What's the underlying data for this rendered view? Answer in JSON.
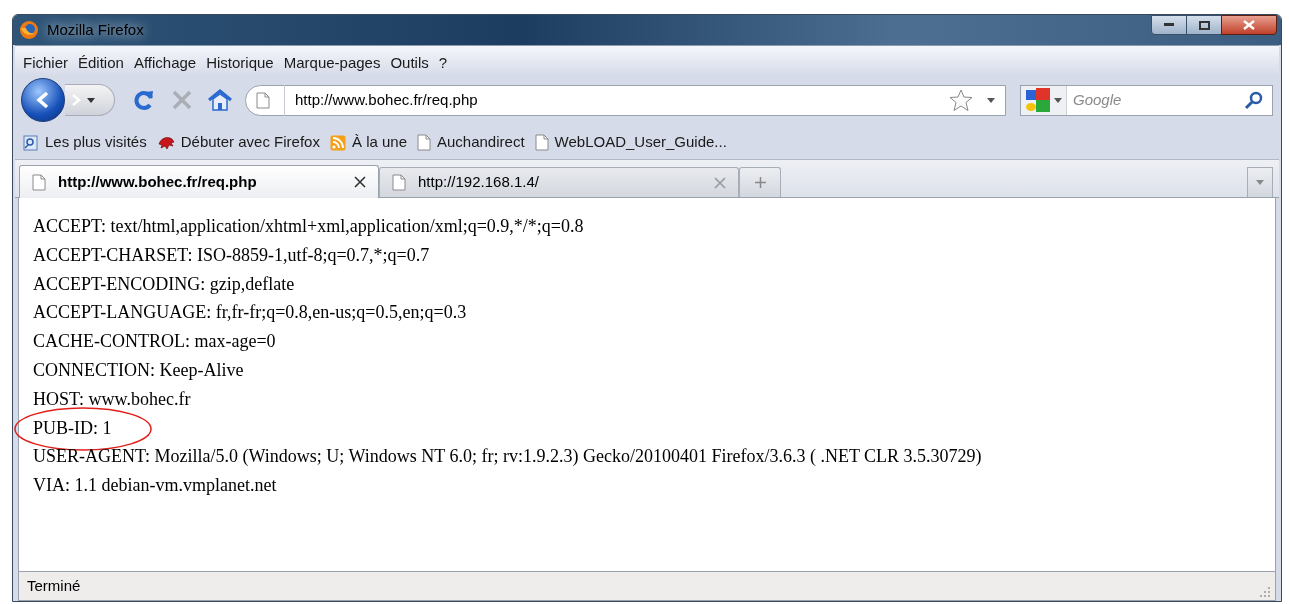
{
  "window": {
    "title": "Mozilla Firefox"
  },
  "menu": [
    "Fichier",
    "Édition",
    "Affichage",
    "Historique",
    "Marque-pages",
    "Outils",
    "?"
  ],
  "address": {
    "value": "http://www.bohec.fr/req.php"
  },
  "search": {
    "placeholder": "Google"
  },
  "bookmarks": [
    {
      "label": "Les plus visités",
      "kind": "smart"
    },
    {
      "label": "Débuter avec Firefox",
      "kind": "dragon"
    },
    {
      "label": "À la une",
      "kind": "feed"
    },
    {
      "label": "Auchandirect",
      "kind": "page"
    },
    {
      "label": "WebLOAD_User_Guide...",
      "kind": "page"
    }
  ],
  "tabs": [
    {
      "label": "http://www.bohec.fr/req.php",
      "selected": true
    },
    {
      "label": "http://192.168.1.4/",
      "selected": false
    }
  ],
  "content": [
    {
      "text": "ACCEPT: text/html,application/xhtml+xml,application/xml;q=0.9,*/*;q=0.8",
      "circled": false
    },
    {
      "text": "ACCEPT-CHARSET: ISO-8859-1,utf-8;q=0.7,*;q=0.7",
      "circled": false
    },
    {
      "text": "ACCEPT-ENCODING: gzip,deflate",
      "circled": false
    },
    {
      "text": "ACCEPT-LANGUAGE: fr,fr-fr;q=0.8,en-us;q=0.5,en;q=0.3",
      "circled": false
    },
    {
      "text": "CACHE-CONTROL: max-age=0",
      "circled": false
    },
    {
      "text": "CONNECTION: Keep-Alive",
      "circled": false
    },
    {
      "text": "HOST: www.bohec.fr",
      "circled": false
    },
    {
      "text": "PUB-ID: 1",
      "circled": true
    },
    {
      "text": "USER-AGENT: Mozilla/5.0 (Windows; U; Windows NT 6.0; fr; rv:1.9.2.3) Gecko/20100401 Firefox/3.6.3 ( .NET CLR 3.5.30729)",
      "circled": false
    },
    {
      "text": "VIA: 1.1 debian-vm.vmplanet.net",
      "circled": false
    }
  ],
  "status_bar": {
    "text": "Terminé"
  }
}
